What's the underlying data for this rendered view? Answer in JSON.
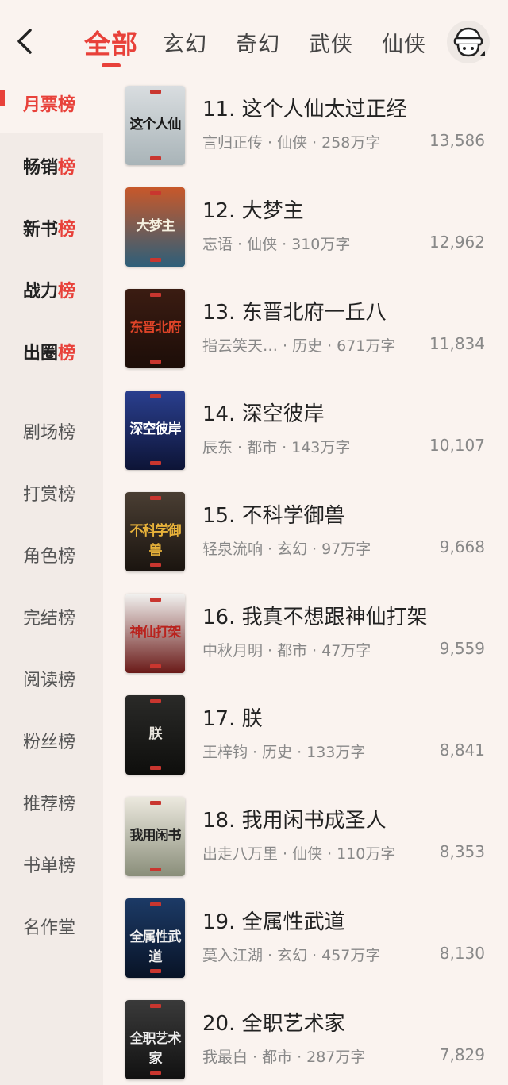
{
  "header": {
    "tabs": [
      "全部",
      "玄幻",
      "奇幻",
      "武侠",
      "仙侠"
    ],
    "active_tab": 0
  },
  "sidebar": {
    "items": [
      {
        "label": "月票榜",
        "state": "active"
      },
      {
        "label": "畅销",
        "suffix": "榜",
        "state": "bold"
      },
      {
        "label": "新书",
        "suffix": "榜",
        "state": "bold"
      },
      {
        "label": "战力",
        "suffix": "榜",
        "state": "bold"
      },
      {
        "label": "出圈",
        "suffix": "榜",
        "state": "bold"
      },
      {
        "label": "剧场榜",
        "state": "plain"
      },
      {
        "label": "打赏榜",
        "state": "plain"
      },
      {
        "label": "角色榜",
        "state": "plain"
      },
      {
        "label": "完结榜",
        "state": "plain"
      },
      {
        "label": "阅读榜",
        "state": "plain"
      },
      {
        "label": "粉丝榜",
        "state": "plain"
      },
      {
        "label": "推荐榜",
        "state": "plain"
      },
      {
        "label": "书单榜",
        "state": "plain"
      },
      {
        "label": "名作堂",
        "state": "plain"
      }
    ]
  },
  "books": [
    {
      "title": "11. 这个人仙太过正经",
      "author": "言归正传",
      "genre": "仙侠",
      "words": "258万字",
      "count": "13,586",
      "cover": {
        "text": "这个人仙",
        "bg": "#d9dde0",
        "bg2": "#a9b4b8",
        "fg": "#1a1a1a"
      }
    },
    {
      "title": "12. 大梦主",
      "author": "忘语",
      "genre": "仙侠",
      "words": "310万字",
      "count": "12,962",
      "cover": {
        "text": "大梦主",
        "bg": "#c8582a",
        "bg2": "#2d5f7a",
        "fg": "#f5f0e0"
      }
    },
    {
      "title": "13. 东晋北府一丘八",
      "author": "指云笑天…",
      "genre": "历史",
      "words": "671万字",
      "count": "11,834",
      "cover": {
        "text": "东晋北府",
        "bg": "#3b1c12",
        "bg2": "#1c0d08",
        "fg": "#e04428"
      }
    },
    {
      "title": "14. 深空彼岸",
      "author": "辰东",
      "genre": "都市",
      "words": "143万字",
      "count": "10,107",
      "cover": {
        "text": "深空彼岸",
        "bg": "#2a3f8f",
        "bg2": "#0d1436",
        "fg": "#ffffff"
      }
    },
    {
      "title": "15. 不科学御兽",
      "author": "轻泉流响",
      "genre": "玄幻",
      "words": "97万字",
      "count": "9,668",
      "cover": {
        "text": "不科学御兽",
        "bg": "#4a3e33",
        "bg2": "#1a140f",
        "fg": "#e8b23a"
      }
    },
    {
      "title": "16. 我真不想跟神仙打架",
      "author": "中秋月明",
      "genre": "都市",
      "words": "47万字",
      "count": "9,559",
      "cover": {
        "text": "神仙打架",
        "bg": "#f2f2f0",
        "bg2": "#6a1a18",
        "fg": "#b9231e"
      }
    },
    {
      "title": "17. 朕",
      "author": "王梓钧",
      "genre": "历史",
      "words": "133万字",
      "count": "8,841",
      "cover": {
        "text": "朕",
        "bg": "#2a2a28",
        "bg2": "#0e0e0c",
        "fg": "#e8e4dc"
      }
    },
    {
      "title": "18. 我用闲书成圣人",
      "author": "出走八万里",
      "genre": "仙侠",
      "words": "110万字",
      "count": "8,353",
      "cover": {
        "text": "我用闲书",
        "bg": "#ece9df",
        "bg2": "#8a8e7a",
        "fg": "#222222"
      }
    },
    {
      "title": "19. 全属性武道",
      "author": "莫入江湖",
      "genre": "玄幻",
      "words": "457万字",
      "count": "8,130",
      "cover": {
        "text": "全属性武道",
        "bg": "#1c3a66",
        "bg2": "#081326",
        "fg": "#f0f0f0"
      }
    },
    {
      "title": "20. 全职艺术家",
      "author": "我最白",
      "genre": "都市",
      "words": "287万字",
      "count": "7,829",
      "cover": {
        "text": "全职艺术家",
        "bg": "#3a3a3a",
        "bg2": "#111111",
        "fg": "#eeeeee"
      }
    }
  ]
}
